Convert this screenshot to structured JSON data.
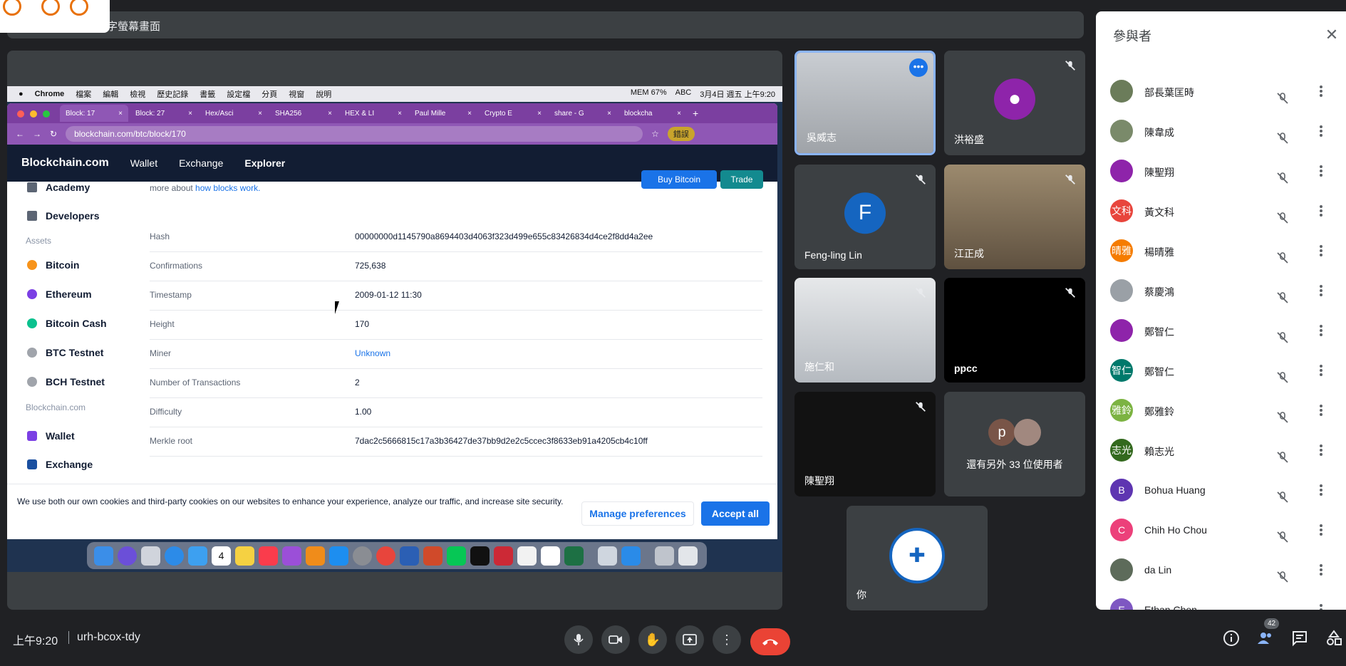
{
  "share_banner": {
    "text": "字螢幕畫面"
  },
  "mac_menubar": {
    "items": [
      "Chrome",
      "檔案",
      "編輯",
      "檢視",
      "歷史記錄",
      "書籤",
      "設定檔",
      "分頁",
      "視窗",
      "說明"
    ],
    "mem": "MEM 67%",
    "abc": "ABC",
    "datetime": "3月4日 週五 上午9:20"
  },
  "browser": {
    "tabs": [
      "Block: 17",
      "Block: 27",
      "Hex/Asci",
      "SHA256",
      "HEX & LI",
      "Paul Mille",
      "Crypto E",
      "share - G",
      "blockcha"
    ],
    "url": "blockchain.com/btc/block/170",
    "error_pill": "錯誤"
  },
  "bc_nav": {
    "logo": "Blockchain.com",
    "links": [
      "Wallet",
      "Exchange",
      "Explorer"
    ],
    "buy": "Buy Bitcoin",
    "trade": "Trade"
  },
  "intro": {
    "text": "more about ",
    "link": "how blocks work."
  },
  "sidebar": {
    "academy": "Academy",
    "developers": "Developers",
    "assets_heading": "Assets",
    "assets": [
      {
        "label": "Bitcoin",
        "color": "#f7931a"
      },
      {
        "label": "Ethereum",
        "color": "#7b3fe4"
      },
      {
        "label": "Bitcoin Cash",
        "color": "#0ac18e"
      },
      {
        "label": "BTC Testnet",
        "color": "#a0a4ab"
      },
      {
        "label": "BCH Testnet",
        "color": "#a0a4ab"
      }
    ],
    "company_heading": "Blockchain.com",
    "wallet": "Wallet",
    "exchange": "Exchange"
  },
  "block_table": [
    {
      "key": "Hash",
      "value": "00000000d1145790a8694403d4063f323d499e655c83426834d4ce2f8dd4a2ee"
    },
    {
      "key": "Confirmations",
      "value": "725,638"
    },
    {
      "key": "Timestamp",
      "value": "2009-01-12 11:30"
    },
    {
      "key": "Height",
      "value": "170"
    },
    {
      "key": "Miner",
      "value": "Unknown"
    },
    {
      "key": "Number of Transactions",
      "value": "2"
    },
    {
      "key": "Difficulty",
      "value": "1.00"
    },
    {
      "key": "Merkle root",
      "value": "7dac2c5666815c17a3b36427de37bb9d2e2c5ccec3f8633eb91a4205cb4c10ff"
    }
  ],
  "cookie": {
    "message": "We use both our own cookies and third-party cookies on our websites to enhance your experience, analyze our traffic, and increase site security.",
    "manage": "Manage preferences",
    "accept": "Accept all"
  },
  "dock": {
    "calendar_day": "4"
  },
  "tiles": [
    {
      "name": "吳威志",
      "type": "camera"
    },
    {
      "name": "洪裕盛",
      "type": "avatar"
    },
    {
      "name": "Feng-ling Lin",
      "type": "letter",
      "letter": "F"
    },
    {
      "name": "江正成",
      "type": "camera"
    },
    {
      "name": "施仁和",
      "type": "camera"
    },
    {
      "name": "ppcc",
      "type": "black"
    },
    {
      "name": "陳聖翔",
      "type": "black"
    },
    {
      "name": "還有另外 33 位使用者",
      "type": "others",
      "letter": "p"
    },
    {
      "name": "你",
      "type": "self"
    }
  ],
  "participants_panel": {
    "title": "參與者",
    "people": [
      {
        "name": "部長葉匡時",
        "avatar": "",
        "color": "#6b7c5a"
      },
      {
        "name": "陳韋成",
        "avatar": "",
        "color": "#7a8a6a"
      },
      {
        "name": "陳聖翔",
        "avatar": "",
        "color": "#8e24aa"
      },
      {
        "name": "黃文科",
        "avatar": "文科",
        "color": "#e8453c"
      },
      {
        "name": "楊晴雅",
        "avatar": "晴雅",
        "color": "#f57c00"
      },
      {
        "name": "蔡慶鴻",
        "avatar": "",
        "color": "#9aa0a6"
      },
      {
        "name": "鄭智仁",
        "avatar": "",
        "color": "#8e24aa"
      },
      {
        "name": "鄭智仁",
        "avatar": "智仁",
        "color": "#00796b"
      },
      {
        "name": "鄭雅鈴",
        "avatar": "雅鈴",
        "color": "#7cb342"
      },
      {
        "name": "賴志光",
        "avatar": "志光",
        "color": "#33691e"
      },
      {
        "name": "Bohua Huang",
        "avatar": "B",
        "color": "#5e35b1"
      },
      {
        "name": "Chih Ho Chou",
        "avatar": "C",
        "color": "#ec407a"
      },
      {
        "name": "da Lin",
        "avatar": "",
        "color": "#5d6b5a"
      },
      {
        "name": "Ethan Chen",
        "avatar": "E",
        "color": "#7e57c2"
      }
    ]
  },
  "bottom": {
    "time": "上午9:20",
    "meeting_code": "urh-bcox-tdy",
    "participant_count": "42"
  }
}
